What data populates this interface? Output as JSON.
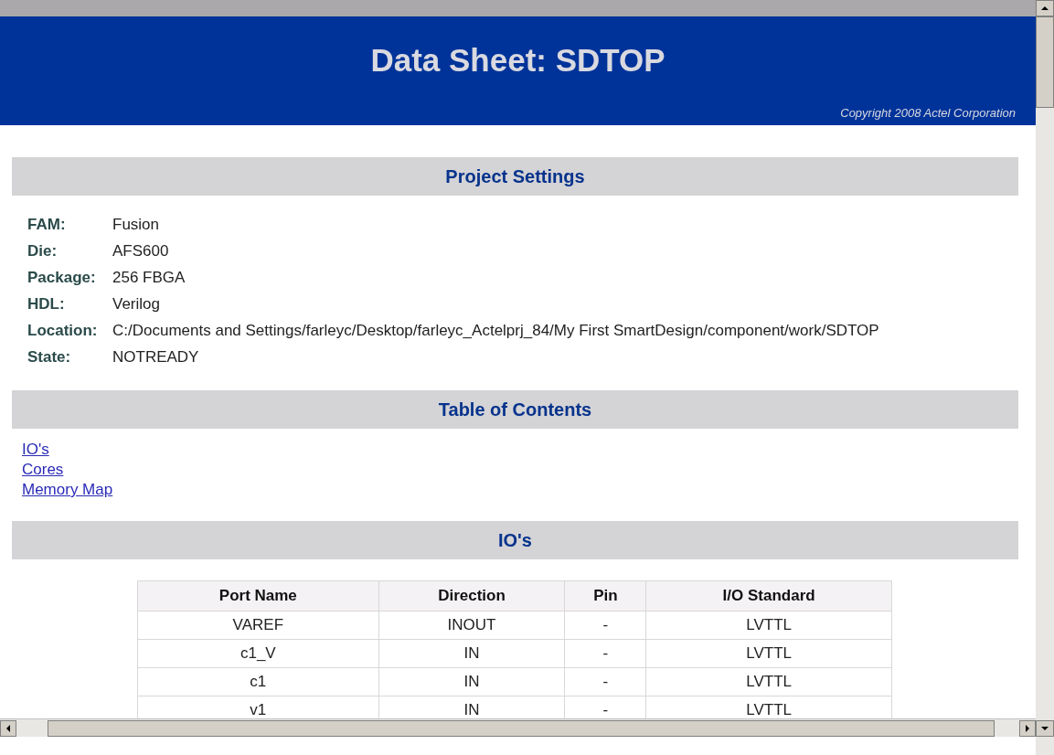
{
  "header": {
    "title": "Data Sheet: SDTOP",
    "copyright": "Copyright 2008 Actel Corporation"
  },
  "project_settings": {
    "heading": "Project Settings",
    "fields": [
      {
        "label": "FAM:",
        "value": "Fusion"
      },
      {
        "label": "Die:",
        "value": "AFS600"
      },
      {
        "label": "Package:",
        "value": "256 FBGA"
      },
      {
        "label": "HDL:",
        "value": "Verilog"
      },
      {
        "label": "Location:",
        "value": "C:/Documents and Settings/farleyc/Desktop/farleyc_Actelprj_84/My First SmartDesign/component/work/SDTOP"
      },
      {
        "label": "State:",
        "value": "NOTREADY"
      }
    ]
  },
  "table_of_contents": {
    "heading": "Table of Contents",
    "links": [
      "IO's",
      "Cores",
      "Memory Map"
    ]
  },
  "ios": {
    "heading": "IO's",
    "columns": [
      "Port Name",
      "Direction",
      "Pin",
      "I/O Standard"
    ],
    "rows": [
      [
        "VAREF",
        "INOUT",
        "-",
        "LVTTL"
      ],
      [
        "c1_V",
        "IN",
        "-",
        "LVTTL"
      ],
      [
        "c1",
        "IN",
        "-",
        "LVTTL"
      ],
      [
        "v1",
        "IN",
        "-",
        "LVTTL"
      ]
    ]
  }
}
